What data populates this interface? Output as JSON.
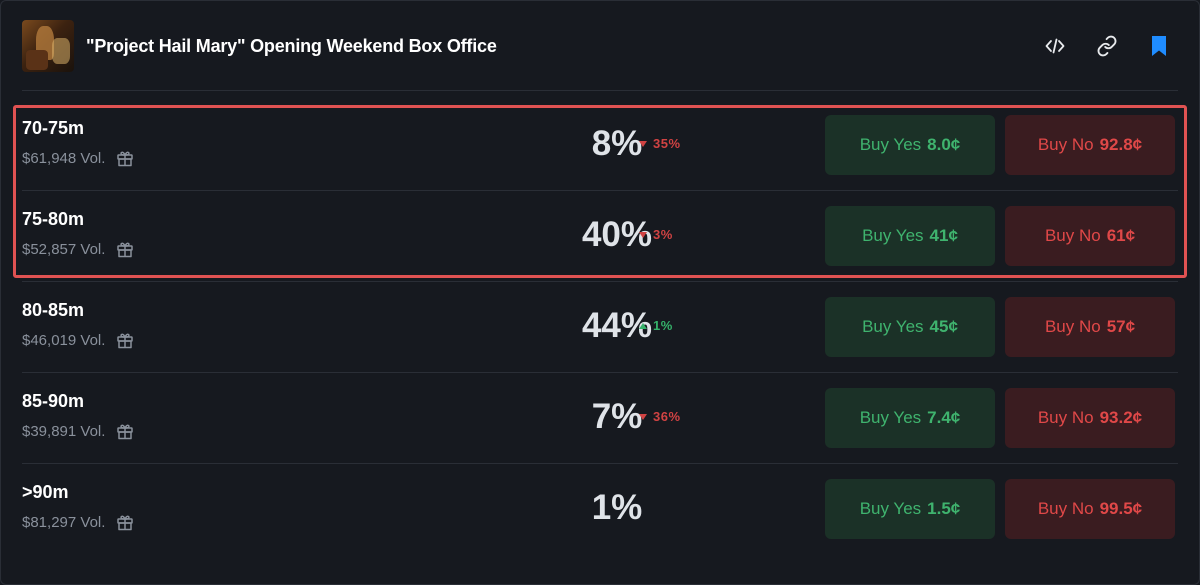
{
  "header": {
    "title": "\"Project Hail Mary\" Opening Weekend Box Office",
    "actions": [
      {
        "icon": "code-icon"
      },
      {
        "icon": "link-icon"
      },
      {
        "icon": "bookmark-icon"
      }
    ]
  },
  "colors": {
    "background": "#16191f",
    "yes_text": "#3fb36e",
    "yes_bg": "#1b3127",
    "no_text": "#e04848",
    "no_bg": "#3a1c20",
    "highlight": "#e05252",
    "bookmark": "#1f8cff"
  },
  "rows": [
    {
      "label": "70-75m",
      "volume": "$61,948 Vol.",
      "percent": "8%",
      "change": "35%",
      "change_dir": "down",
      "yes_label": "Buy Yes",
      "yes_price": "8.0¢",
      "no_label": "Buy No",
      "no_price": "92.8¢"
    },
    {
      "label": "75-80m",
      "volume": "$52,857 Vol.",
      "percent": "40%",
      "change": "3%",
      "change_dir": "down",
      "yes_label": "Buy Yes",
      "yes_price": "41¢",
      "no_label": "Buy No",
      "no_price": "61¢"
    },
    {
      "label": "80-85m",
      "volume": "$46,019 Vol.",
      "percent": "44%",
      "change": "1%",
      "change_dir": "up",
      "yes_label": "Buy Yes",
      "yes_price": "45¢",
      "no_label": "Buy No",
      "no_price": "57¢"
    },
    {
      "label": "85-90m",
      "volume": "$39,891 Vol.",
      "percent": "7%",
      "change": "36%",
      "change_dir": "down",
      "yes_label": "Buy Yes",
      "yes_price": "7.4¢",
      "no_label": "Buy No",
      "no_price": "93.2¢"
    },
    {
      "label": ">90m",
      "volume": "$81,297 Vol.",
      "percent": "1%",
      "change": "",
      "change_dir": "none",
      "yes_label": "Buy Yes",
      "yes_price": "1.5¢",
      "no_label": "Buy No",
      "no_price": "99.5¢"
    }
  ]
}
